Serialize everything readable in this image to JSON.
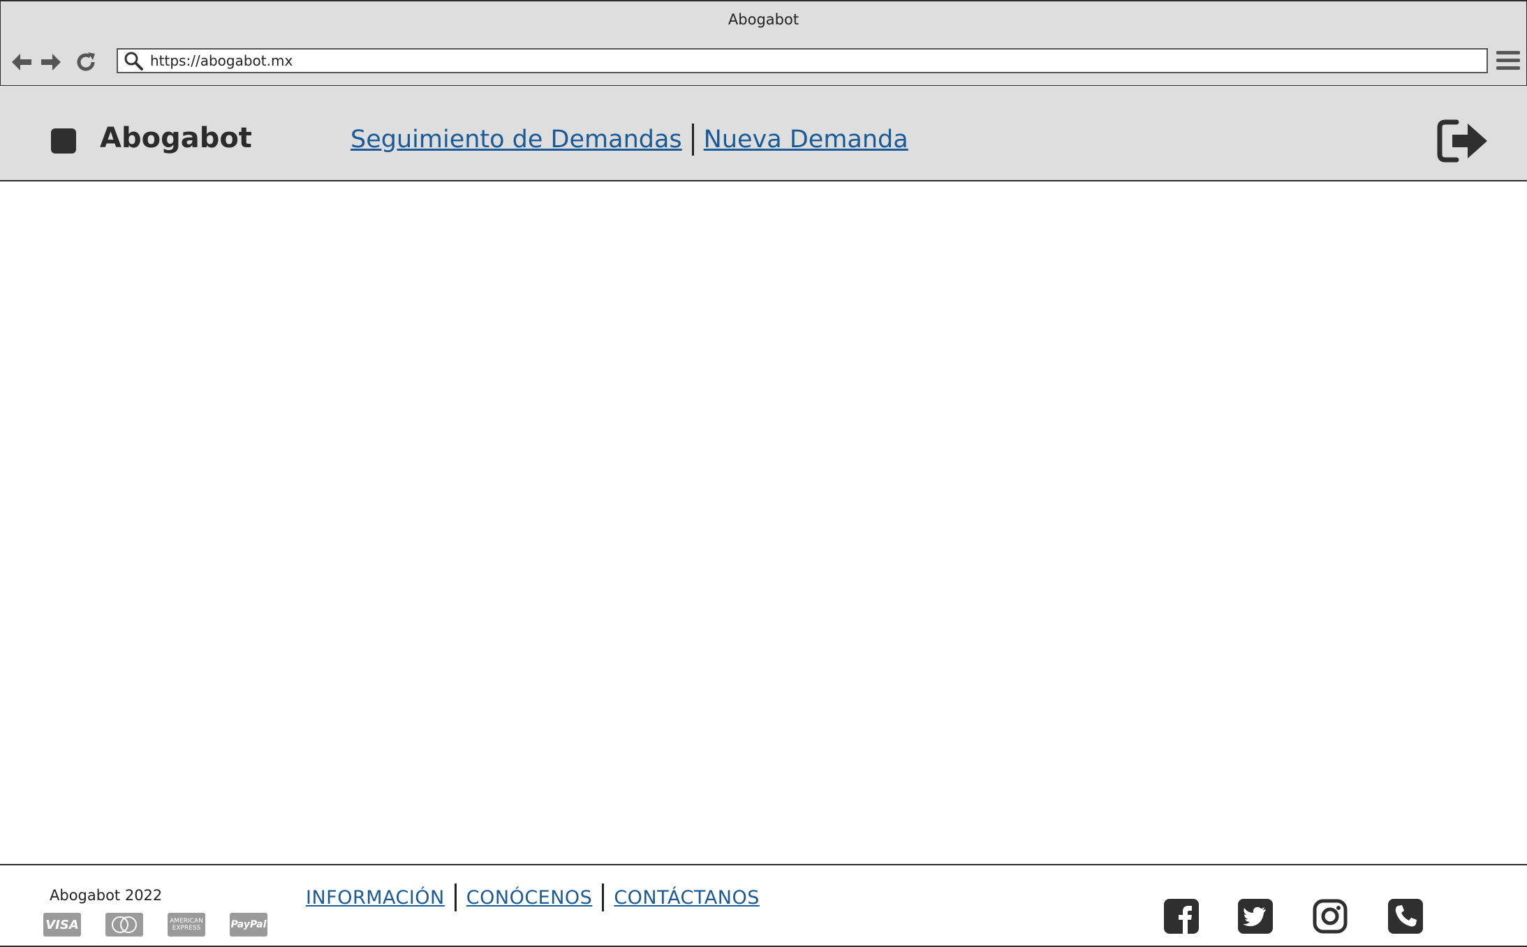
{
  "browser": {
    "title": "Abogabot",
    "url": "https://abogabot.mx"
  },
  "header": {
    "brand": "Abogabot",
    "nav": [
      {
        "label": "Seguimiento de Demandas"
      },
      {
        "label": "Nueva Demanda"
      }
    ]
  },
  "footer": {
    "copyright": "Abogabot 2022",
    "links": [
      {
        "label": "INFORMACIÓN"
      },
      {
        "label": "CONÓCENOS"
      },
      {
        "label": "CONTÁCTANOS"
      }
    ],
    "payments": {
      "visa": "VISA",
      "amex": "AMERICAN EXPRESS",
      "paypal": "PayPal"
    },
    "social_icons": [
      "facebook-icon",
      "twitter-icon",
      "instagram-icon",
      "phone-icon"
    ]
  }
}
